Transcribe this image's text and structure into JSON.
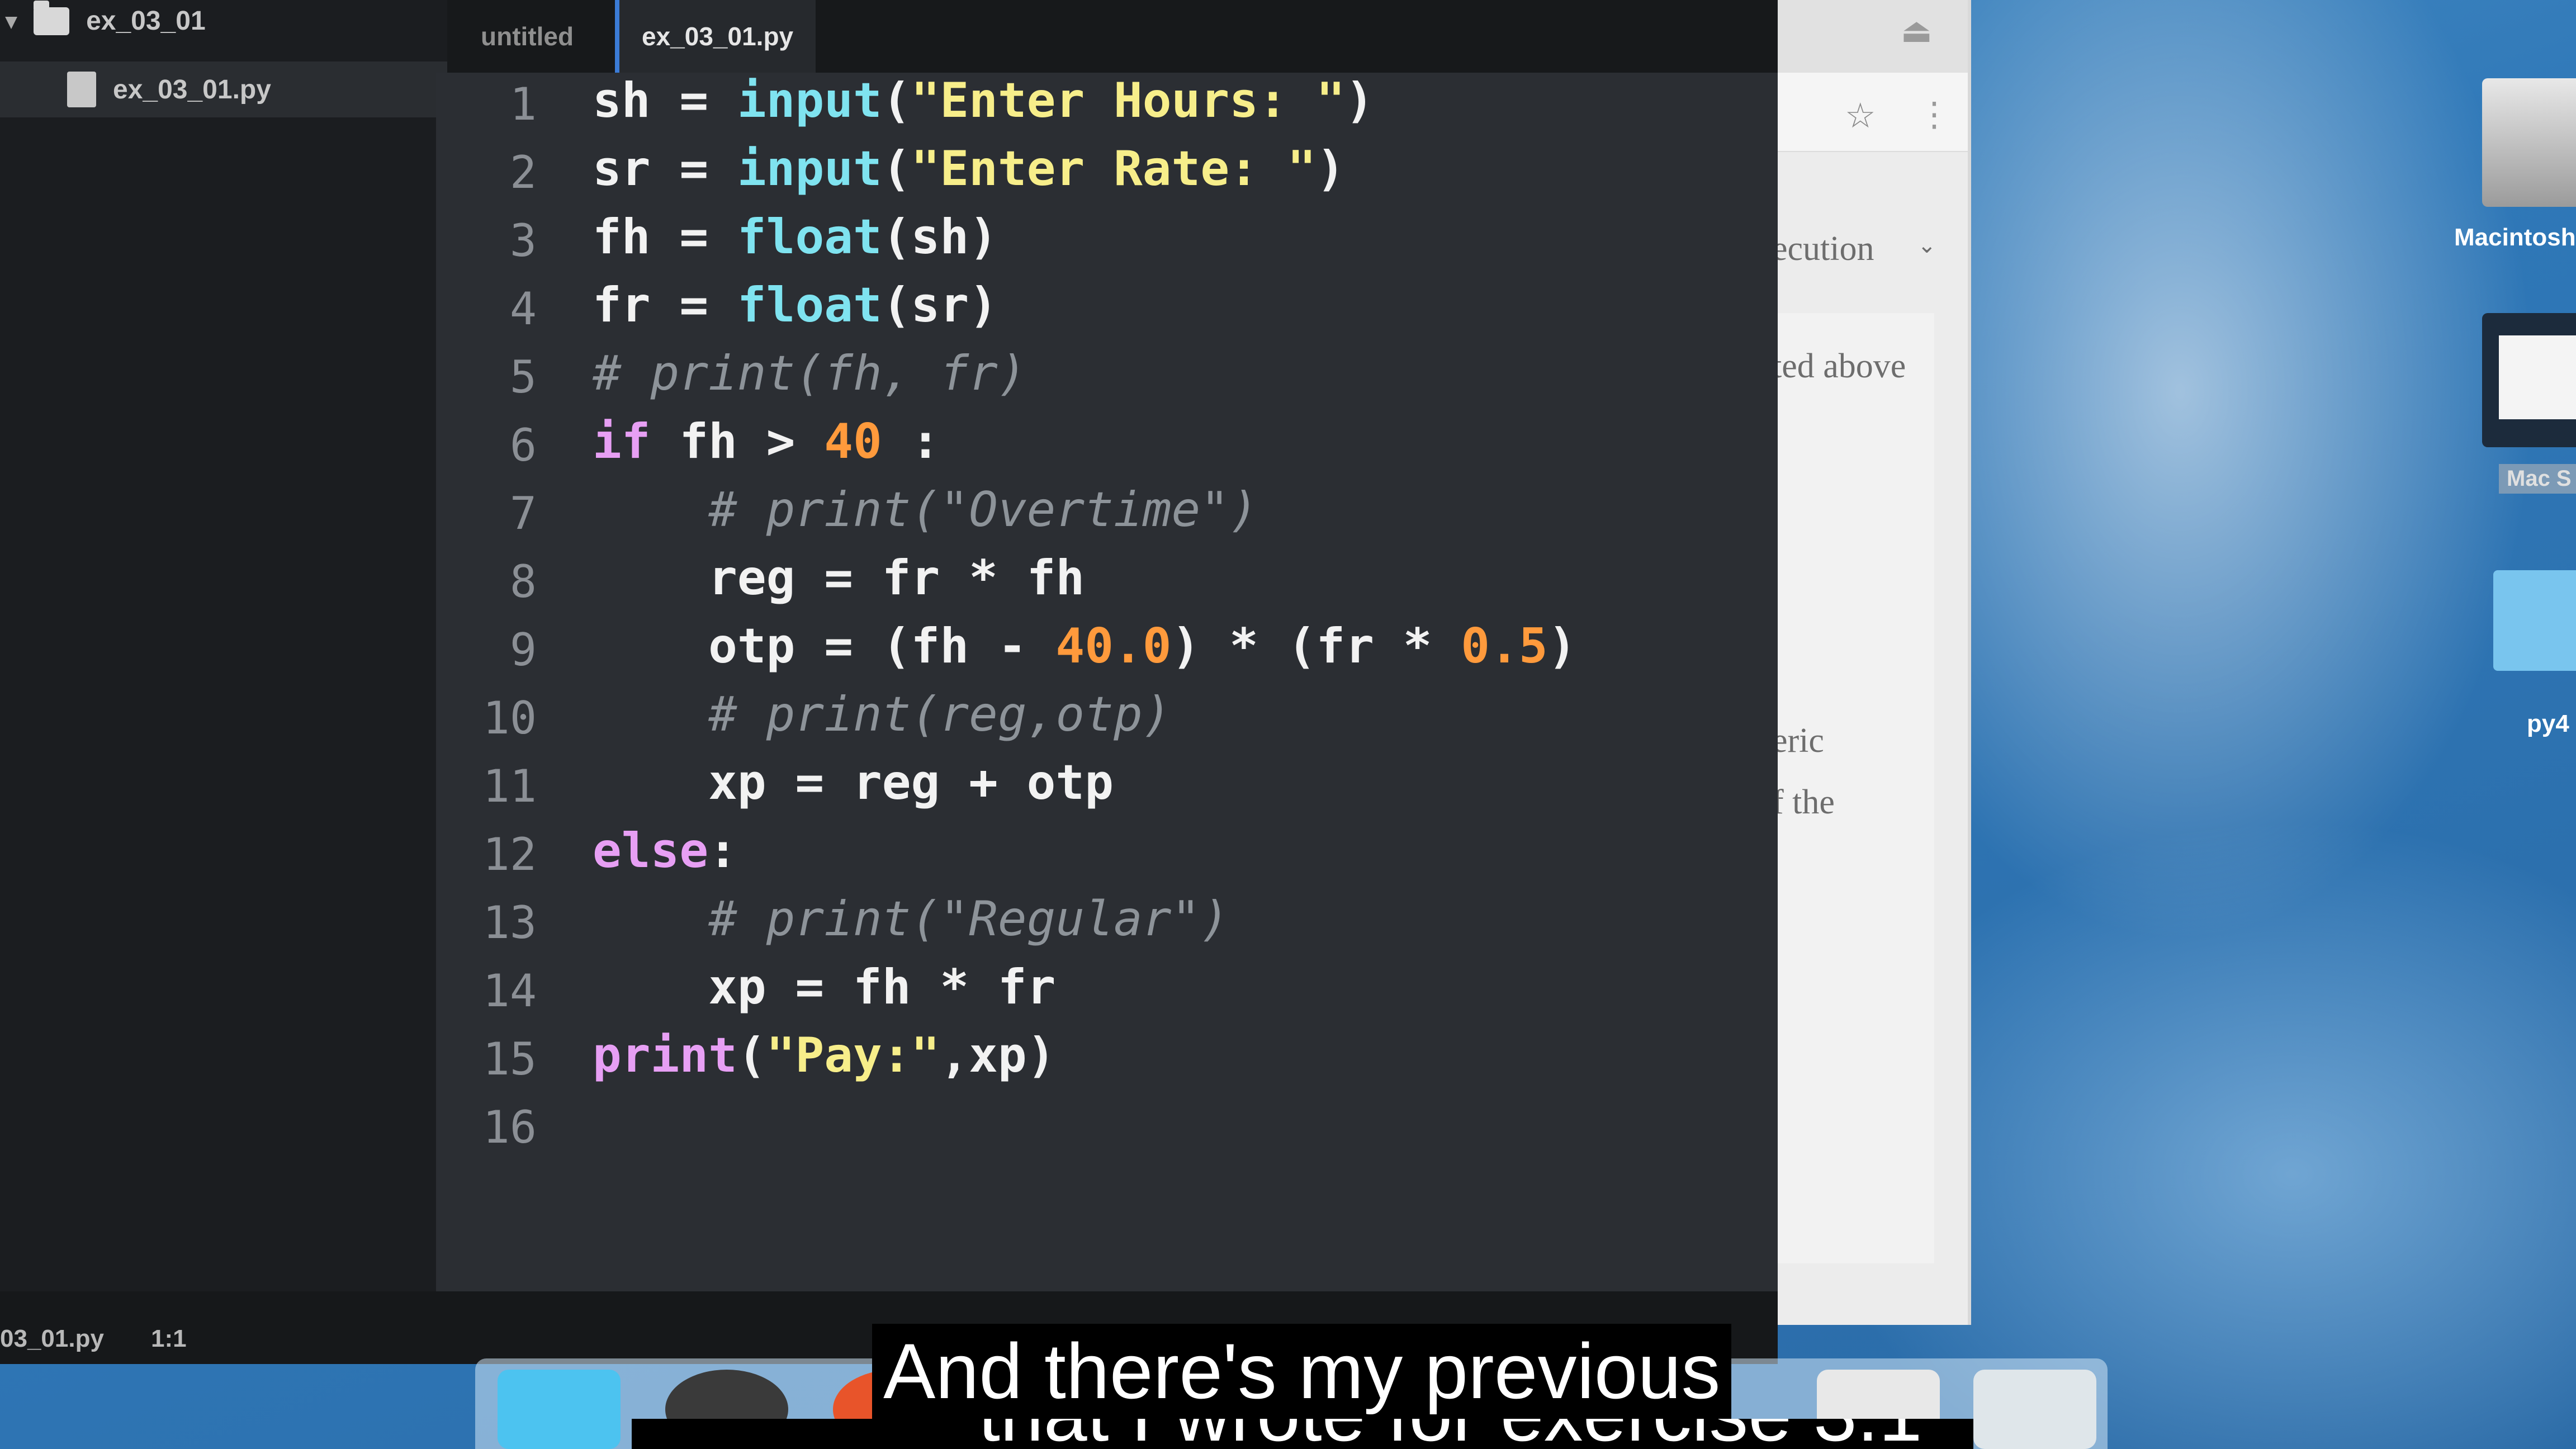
{
  "sidebar": {
    "folder_name": "ex_03_01",
    "file_name": "ex_03_01.py"
  },
  "tabs": [
    {
      "label": "untitled"
    },
    {
      "label": "ex_03_01.py"
    }
  ],
  "status": {
    "file": "03_01.py",
    "position": "1:1"
  },
  "code_lines": [
    "1",
    "2",
    "3",
    "4",
    "5",
    "6",
    "7",
    "8",
    "9",
    "10",
    "11",
    "12",
    "13",
    "14",
    "15",
    "16"
  ],
  "code": {
    "l1": {
      "a": "sh = ",
      "b": "input",
      "c": "(",
      "d": "\"Enter Hours: \"",
      "e": ")"
    },
    "l2": {
      "a": "sr = ",
      "b": "input",
      "c": "(",
      "d": "\"Enter Rate: \"",
      "e": ")"
    },
    "l3": {
      "a": "fh = ",
      "b": "float",
      "c": "(sh)"
    },
    "l4": {
      "a": "fr = ",
      "b": "float",
      "c": "(sr)"
    },
    "l5": {
      "a": "# print(fh, fr)"
    },
    "l6": {
      "a": "if",
      "b": " fh > ",
      "c": "40",
      "d": " :"
    },
    "l7": {
      "a": "    # print(\"Overtime\")"
    },
    "l8": {
      "a": "    reg = fr * fh"
    },
    "l9": {
      "a": "    otp = (fh - ",
      "b": "40.0",
      "c": ") * (fr * ",
      "d": "0.5",
      "e": ")"
    },
    "l10": {
      "a": "    # print(reg,otp)"
    },
    "l11": {
      "a": "    xp = reg + otp"
    },
    "l12": {
      "a": "else",
      "b": ":"
    },
    "l13": {
      "a": "    # print(\"Regular\")"
    },
    "l14": {
      "a": "    xp = fh * fr"
    },
    "l15": {
      "a": "print",
      "b": "(",
      "c": "\"Pay:\"",
      "d": ",xp)"
    }
  },
  "browser": {
    "dropdown": "ecution",
    "text1": "ted above",
    "text2": "eric",
    "text3": "f the"
  },
  "desktop": {
    "drive1_label": "Macintosh",
    "drive2_label": "Mac S",
    "folder_label": "py4"
  },
  "caption": {
    "line1": "And there's my previous",
    "line2": "that I wrote for exercise 3.1"
  },
  "colors": {
    "keyword": "#e79ff4",
    "function": "#7fe3f0",
    "string": "#f7ee8a",
    "number": "#ff9a3c",
    "comment": "#8d9399"
  }
}
